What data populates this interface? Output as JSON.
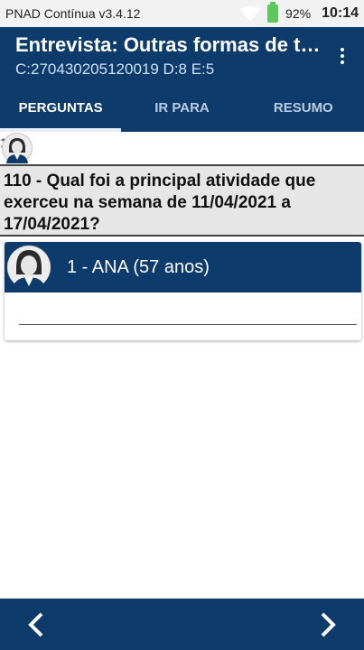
{
  "status_bar": {
    "app_name": "PNAD Contínua v3.4.12",
    "battery_pct": "92%",
    "time": "10:14"
  },
  "app_bar": {
    "title": "Entrevista: Outras formas de trabalho",
    "subtitle": "C:270430205120019 D:8 E:5"
  },
  "tabs": [
    {
      "label": "PERGUNTAS",
      "active": true
    },
    {
      "label": "IR PARA",
      "active": false
    },
    {
      "label": "RESUMO",
      "active": false
    }
  ],
  "mini_row": {
    "number": "1"
  },
  "question": {
    "text": "110 - Qual foi a principal atividade que exerceu na semana de 11/04/2021 a 17/04/2021?"
  },
  "person": {
    "label": "1 - ANA (57 anos)",
    "answer_value": ""
  },
  "colors": {
    "primary": "#0d3b6b",
    "question_bg": "#e6e6e6",
    "battery": "#5cc75c"
  },
  "icons": {
    "wifi": "wifi-icon",
    "battery": "battery-icon",
    "overflow": "more-vert-icon",
    "avatar": "person-avatar-icon",
    "prev": "chevron-left-icon",
    "next": "chevron-right-icon"
  }
}
